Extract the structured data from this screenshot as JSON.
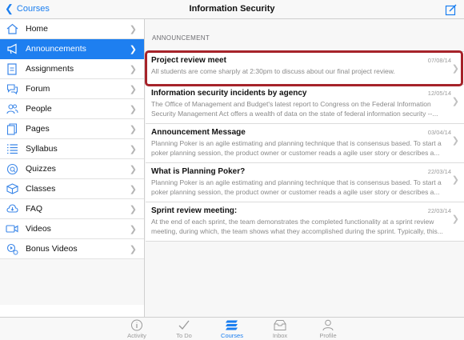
{
  "navbar": {
    "back_label": "Courses",
    "title": "Information Security",
    "compose_icon": "compose-icon"
  },
  "sidebar": {
    "items": [
      {
        "label": "Home",
        "icon": "home-icon",
        "active": false
      },
      {
        "label": "Announcements",
        "icon": "megaphone-icon",
        "active": true
      },
      {
        "label": "Assignments",
        "icon": "assignment-icon",
        "active": false
      },
      {
        "label": "Forum",
        "icon": "forum-icon",
        "active": false
      },
      {
        "label": "People",
        "icon": "people-icon",
        "active": false
      },
      {
        "label": "Pages",
        "icon": "pages-icon",
        "active": false
      },
      {
        "label": "Syllabus",
        "icon": "syllabus-icon",
        "active": false
      },
      {
        "label": "Quizzes",
        "icon": "quiz-icon",
        "active": false
      },
      {
        "label": "Classes",
        "icon": "classes-icon",
        "active": false
      },
      {
        "label": "FAQ",
        "icon": "faq-icon",
        "active": false
      },
      {
        "label": "Videos",
        "icon": "video-icon",
        "active": false
      },
      {
        "label": "Bonus Videos",
        "icon": "bonus-video-icon",
        "active": false
      }
    ]
  },
  "content": {
    "section_header": "ANNOUNCEMENT",
    "announcements": [
      {
        "title": "Project review meet",
        "date": "07/08/14",
        "lines": [
          "All students are come sharply at 2:30pm to discuss about our final project review."
        ]
      },
      {
        "title": "Information security incidents by agency",
        "date": "12/05/14",
        "lines": [
          "The Office of Management and Budget's latest report to Congress on the Federal Information",
          "Security Management Act offers a wealth of data on the state of federal information security --..."
        ]
      },
      {
        "title": "Announcement Message",
        "date": "03/04/14",
        "lines": [
          "Planning Poker is an agile estimating and planning technique that is consensus based. To start a",
          "poker planning session, the product owner or customer reads a agile user story or describes a..."
        ]
      },
      {
        "title": "What is Planning Poker?",
        "date": "22/03/14",
        "lines": [
          "Planning Poker is an agile estimating and planning technique that is consensus based. To start a",
          "poker planning session, the product owner or customer reads a agile user story or describes a..."
        ]
      },
      {
        "title": "Sprint review meeting:",
        "date": "22/03/14",
        "lines": [
          "At the end of each sprint, the team demonstrates the completed functionality at a sprint review",
          "meeting, during which, the team shows what they accomplished during the sprint. Typically, this..."
        ]
      }
    ]
  },
  "tabbar": {
    "tabs": [
      {
        "label": "Activity",
        "icon": "activity-icon",
        "active": false
      },
      {
        "label": "To Do",
        "icon": "todo-check-icon",
        "active": false
      },
      {
        "label": "Courses",
        "icon": "courses-icon",
        "active": true
      },
      {
        "label": "Inbox",
        "icon": "inbox-icon",
        "active": false
      },
      {
        "label": "Profile",
        "icon": "profile-icon",
        "active": false
      }
    ]
  },
  "colors": {
    "accent": "#1e7ff0",
    "highlight_border": "#a6232a"
  }
}
